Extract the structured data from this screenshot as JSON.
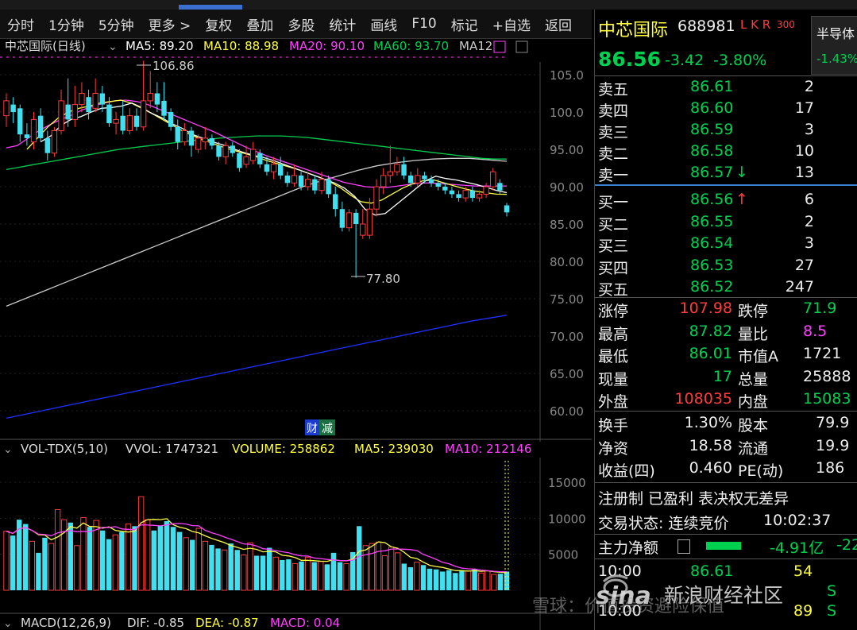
{
  "toolbar": {
    "items": [
      "分时",
      "1分钟",
      "5分钟",
      "更多 >",
      "复权",
      "叠加",
      "多股",
      "统计",
      "画线",
      "F10",
      "标记",
      "+自选",
      "返回"
    ]
  },
  "chart": {
    "main_title": "中芯国际(日线)",
    "ma5": "MA5: 89.20",
    "ma10": "MA10: 88.98",
    "ma20": "MA20: 90.10",
    "ma60": "MA60: 93.70",
    "ma120": "MA12",
    "high_label": "106.86",
    "low_label": "77.80",
    "event_badge_1": "财",
    "event_badge_2": "减",
    "price_ticks": [
      "105.0",
      "100.0",
      "95.00",
      "90.00",
      "85.00",
      "80.00",
      "75.00",
      "70.00",
      "65.00",
      "60.00"
    ],
    "vol_title": "VOL-TDX(5,10)",
    "vvol": "VVOL: 1747321",
    "volume": "VOLUME: 258862",
    "vol_ma5": "MA5: 239030",
    "vol_ma10": "MA10: 212146",
    "vol_ticks": [
      "15000",
      "10000",
      "5000"
    ],
    "macd_title": "MACD(12,26,9)",
    "dif": "DIF: -0.85",
    "dea": "DEA: -0.87",
    "macd": "MACD: 0.04",
    "colors": {
      "up": "#ff3c3c",
      "down": "#40e0f0",
      "ma5": "#ffffff",
      "ma10": "#ffff40",
      "ma20": "#ff40ff",
      "ma60": "#00d050",
      "ma120": "#cccccc",
      "ma250": "#2030ff"
    }
  },
  "chart_data": {
    "type": "candlestick",
    "ylim": [
      58,
      108
    ],
    "price_ticks": [
      105,
      100,
      95,
      90,
      85,
      80,
      75,
      70,
      65,
      60
    ],
    "candles": [
      [
        99.5,
        101.5,
        98.0,
        102.5,
        "up"
      ],
      [
        101.0,
        100.0,
        98.5,
        102.0,
        "down"
      ],
      [
        100.5,
        97.0,
        96.0,
        101.0,
        "down"
      ],
      [
        97.0,
        96.5,
        95.5,
        98.5,
        "down"
      ],
      [
        96.0,
        99.0,
        95.0,
        100.0,
        "up"
      ],
      [
        99.5,
        96.5,
        96.0,
        100.5,
        "down"
      ],
      [
        96.5,
        94.5,
        93.5,
        97.5,
        "down"
      ],
      [
        94.5,
        97.5,
        94.0,
        98.0,
        "up"
      ],
      [
        97.5,
        101.5,
        97.0,
        103.0,
        "up"
      ],
      [
        101.0,
        99.0,
        98.0,
        104.5,
        "down"
      ],
      [
        99.0,
        101.0,
        98.0,
        103.5,
        "up"
      ],
      [
        101.0,
        102.5,
        100.0,
        104.0,
        "up"
      ],
      [
        102.0,
        100.0,
        99.0,
        103.0,
        "down"
      ],
      [
        100.5,
        102.5,
        100.0,
        104.5,
        "up"
      ],
      [
        102.5,
        101.0,
        100.0,
        103.5,
        "down"
      ],
      [
        101.0,
        98.5,
        98.0,
        102.0,
        "down"
      ],
      [
        98.5,
        99.0,
        97.0,
        100.0,
        "up"
      ],
      [
        99.5,
        97.5,
        97.0,
        101.5,
        "down"
      ],
      [
        97.5,
        99.5,
        97.0,
        100.5,
        "up"
      ],
      [
        99.5,
        98.0,
        97.5,
        100.5,
        "down"
      ],
      [
        98.0,
        101.5,
        97.5,
        106.86,
        "up"
      ],
      [
        101.5,
        102.5,
        100.5,
        105.5,
        "up"
      ],
      [
        102.5,
        101.0,
        100.0,
        104.0,
        "down"
      ],
      [
        101.5,
        99.5,
        99.0,
        104.0,
        "down"
      ],
      [
        100.0,
        98.0,
        97.5,
        100.5,
        "down"
      ],
      [
        98.0,
        96.0,
        95.0,
        99.0,
        "down"
      ],
      [
        96.0,
        97.5,
        95.5,
        98.5,
        "up"
      ],
      [
        97.5,
        95.5,
        94.0,
        98.0,
        "down"
      ],
      [
        95.0,
        96.5,
        94.5,
        97.0,
        "up"
      ],
      [
        96.0,
        96.5,
        95.0,
        98.0,
        "up"
      ],
      [
        96.5,
        95.5,
        95.0,
        97.0,
        "down"
      ],
      [
        95.5,
        94.0,
        93.5,
        96.0,
        "down"
      ],
      [
        94.0,
        95.5,
        93.0,
        96.0,
        "up"
      ],
      [
        95.5,
        94.5,
        94.0,
        96.0,
        "down"
      ],
      [
        94.5,
        92.5,
        92.0,
        95.0,
        "down"
      ],
      [
        93.0,
        94.0,
        92.5,
        95.5,
        "up"
      ],
      [
        93.5,
        95.0,
        93.0,
        96.0,
        "up"
      ],
      [
        94.5,
        93.0,
        92.5,
        95.0,
        "down"
      ],
      [
        93.0,
        92.0,
        91.5,
        94.0,
        "down"
      ],
      [
        92.0,
        93.0,
        91.0,
        94.0,
        "up"
      ],
      [
        93.0,
        91.5,
        91.0,
        94.0,
        "down"
      ],
      [
        91.5,
        90.5,
        90.0,
        92.0,
        "down"
      ],
      [
        90.5,
        91.5,
        90.0,
        93.0,
        "up"
      ],
      [
        91.5,
        90.0,
        89.5,
        92.0,
        "down"
      ],
      [
        90.0,
        91.0,
        89.5,
        92.0,
        "up"
      ],
      [
        91.0,
        89.5,
        89.0,
        91.5,
        "down"
      ],
      [
        89.5,
        91.0,
        89.0,
        92.0,
        "up"
      ],
      [
        91.0,
        89.0,
        88.5,
        91.5,
        "down"
      ],
      [
        89.0,
        87.0,
        86.0,
        90.0,
        "down"
      ],
      [
        87.0,
        84.5,
        84.0,
        88.0,
        "down"
      ],
      [
        84.5,
        86.5,
        84.0,
        87.0,
        "up"
      ],
      [
        86.5,
        85.0,
        77.8,
        87.0,
        "down"
      ],
      [
        85.0,
        83.5,
        83.0,
        87.0,
        "up"
      ],
      [
        83.5,
        87.0,
        83.0,
        88.5,
        "up"
      ],
      [
        87.0,
        90.0,
        86.0,
        91.0,
        "up"
      ],
      [
        90.0,
        91.5,
        89.0,
        92.5,
        "up"
      ],
      [
        91.5,
        92.0,
        90.5,
        95.5,
        "up"
      ],
      [
        92.0,
        93.0,
        91.5,
        94.0,
        "up"
      ],
      [
        93.0,
        91.5,
        91.0,
        94.0,
        "down"
      ],
      [
        91.5,
        90.5,
        90.0,
        92.0,
        "down"
      ],
      [
        90.5,
        91.5,
        90.0,
        92.5,
        "up"
      ],
      [
        91.5,
        91.0,
        90.5,
        92.0,
        "down"
      ],
      [
        91.0,
        90.5,
        90.0,
        91.5,
        "down"
      ],
      [
        90.5,
        90.0,
        89.5,
        91.0,
        "down"
      ],
      [
        90.0,
        89.5,
        89.0,
        90.5,
        "down"
      ],
      [
        89.5,
        89.0,
        88.5,
        90.0,
        "down"
      ],
      [
        89.0,
        88.5,
        88.0,
        89.5,
        "down"
      ],
      [
        88.5,
        89.5,
        88.0,
        90.0,
        "up"
      ],
      [
        89.5,
        88.5,
        88.0,
        90.0,
        "down"
      ],
      [
        88.5,
        89.0,
        88.0,
        89.5,
        "up"
      ],
      [
        89.0,
        90.0,
        88.5,
        90.5,
        "up"
      ],
      [
        90.0,
        92.0,
        89.5,
        92.5,
        "up"
      ],
      [
        90.5,
        89.5,
        89.0,
        91.0,
        "down"
      ],
      [
        87.5,
        86.56,
        86.01,
        87.82,
        "down"
      ]
    ],
    "ma5": [
      96.0,
      96.8,
      98.2,
      99.0,
      99.4,
      100.0,
      100.5,
      100.6,
      100.8,
      101.2,
      100.6,
      99.8,
      99.2,
      98.4,
      97.8,
      97.0,
      96.5,
      96.0,
      95.6,
      95.1,
      94.6,
      94.2,
      93.9,
      93.5,
      93.0,
      92.5,
      92.0,
      91.5,
      91.0,
      90.5,
      89.8,
      88.7,
      87.0,
      86.2,
      86.4,
      87.5,
      88.6,
      89.7,
      90.8,
      91.4,
      91.1,
      90.9,
      90.6,
      90.3,
      89.9,
      89.5,
      89.2
    ],
    "ma10": [
      95.0,
      96.5,
      98.0,
      99.2,
      100.0,
      100.5,
      100.8,
      101.2,
      101.4,
      101.6,
      101.2,
      100.5,
      99.8,
      99.0,
      98.2,
      97.4,
      96.8,
      96.2,
      95.7,
      95.2,
      94.8,
      94.4,
      94.0,
      93.5,
      93.1,
      92.7,
      92.3,
      91.8,
      91.3,
      90.7,
      89.9,
      88.9,
      88.0,
      87.8,
      88.2,
      89.0,
      89.8,
      90.4,
      90.8,
      90.9,
      90.5,
      90.1,
      89.7,
      89.4,
      89.2,
      89.0,
      88.98
    ],
    "ma20": [
      95.2,
      95.5,
      96.5,
      97.5,
      98.3,
      99.0,
      99.6,
      100.3,
      100.8,
      101.2,
      101.5,
      101.6,
      101.4,
      101.0,
      100.4,
      99.8,
      99.2,
      98.6,
      98.0,
      97.4,
      96.7,
      96.0,
      95.3,
      94.7,
      94.1,
      93.6,
      93.1,
      92.6,
      92.1,
      91.6,
      91.1,
      90.6,
      90.3,
      90.0,
      89.9,
      89.9,
      90.1,
      90.3,
      90.5,
      90.5,
      90.4,
      90.3,
      90.2,
      90.1,
      90.1,
      90.1,
      90.1
    ],
    "ma60": [
      92.3,
      92.6,
      92.9,
      93.2,
      93.5,
      93.8,
      94.1,
      94.4,
      94.7,
      95.0,
      95.2,
      95.4,
      95.6,
      95.8,
      96.0,
      96.2,
      96.3,
      96.5,
      96.6,
      96.7,
      96.8,
      96.8,
      96.8,
      96.7,
      96.6,
      96.4,
      96.2,
      96.0,
      95.8,
      95.6,
      95.4,
      95.2,
      95.0,
      94.8,
      94.6,
      94.4,
      94.2,
      94.0,
      93.8,
      93.7,
      93.7
    ],
    "ma120": [
      74.0,
      75.0,
      76.0,
      77.0,
      78.0,
      79.0,
      80.0,
      81.0,
      82.0,
      83.0,
      84.0,
      85.0,
      86.0,
      87.0,
      88.0,
      89.0,
      90.0,
      90.8,
      91.5,
      92.2,
      92.8,
      93.2,
      93.5,
      93.7,
      93.8,
      93.8,
      93.6,
      93.4
    ],
    "ma250": [
      59.0,
      60.0,
      61.0,
      62.0,
      63.0,
      64.0,
      65.0,
      66.0,
      67.0,
      68.0,
      69.0,
      70.0,
      71.0,
      72.0,
      72.8
    ],
    "volume": [
      8200,
      7600,
      9800,
      9200,
      6800,
      5200,
      7300,
      6500,
      11200,
      9800,
      9400,
      6200,
      10100,
      8800,
      9700,
      8300,
      7100,
      7700,
      8100,
      9200,
      8900,
      13000,
      9800,
      8300,
      9000,
      9600,
      8800,
      8100,
      7300,
      7000,
      8600,
      6800,
      6300,
      5800,
      5600,
      6500,
      5600,
      4900,
      6600,
      4800,
      4800,
      5900,
      4600,
      4200,
      4300,
      3700,
      4000,
      4600,
      3900,
      4000,
      3600,
      5200,
      3900,
      3700,
      5300,
      8900,
      6200,
      6500,
      6700,
      4800,
      6000,
      5200,
      3700,
      3200,
      3900,
      3500,
      3000,
      2900,
      2600,
      2800,
      2400,
      2800,
      2700,
      2900,
      2400,
      2700,
      2200,
      2300,
      2600
    ]
  },
  "quote": {
    "name": "中芯国际",
    "code": "688981",
    "tags": "L K R",
    "tag300": "300",
    "price": "86.56",
    "change": "-3.42",
    "change_pct": "-3.80%",
    "sector_name": "半导体",
    "sector_pct": "-1.43%",
    "asks": [
      {
        "label": "卖五",
        "price": "86.61",
        "vol": "2"
      },
      {
        "label": "卖四",
        "price": "86.60",
        "vol": "17"
      },
      {
        "label": "卖三",
        "price": "86.59",
        "vol": "3"
      },
      {
        "label": "卖二",
        "price": "86.58",
        "vol": "10"
      },
      {
        "label": "卖一",
        "price": "86.57",
        "vol": "13",
        "arrow": "↓"
      }
    ],
    "bids": [
      {
        "label": "买一",
        "price": "86.56",
        "vol": "6",
        "arrow": "↑"
      },
      {
        "label": "买二",
        "price": "86.55",
        "vol": "2"
      },
      {
        "label": "买三",
        "price": "86.54",
        "vol": "3"
      },
      {
        "label": "买四",
        "price": "86.53",
        "vol": "27"
      },
      {
        "label": "买五",
        "price": "86.52",
        "vol": "247"
      }
    ],
    "stats": [
      {
        "l1": "涨停",
        "v1": "107.98",
        "c1": "red",
        "l2": "跌停",
        "v2": "71.9",
        "c2": "green"
      },
      {
        "l1": "最高",
        "v1": "87.82",
        "c1": "green",
        "l2": "量比",
        "v2": "8.5",
        "c2": "mag"
      },
      {
        "l1": "最低",
        "v1": "86.01",
        "c1": "green",
        "l2": "市值A",
        "v2": "1721",
        "c2": "white"
      },
      {
        "l1": "现量",
        "v1": "17",
        "c1": "green",
        "l2": "总量",
        "v2": "25888",
        "c2": "white"
      },
      {
        "l1": "外盘",
        "v1": "108035",
        "c1": "red",
        "l2": "内盘",
        "v2": "15083",
        "c2": "green"
      }
    ],
    "stats2": [
      {
        "l1": "换手",
        "v1": "1.30%",
        "l2": "股本",
        "v2": "79.9"
      },
      {
        "l1": "净资",
        "v1": "18.58",
        "l2": "流通",
        "v2": "19.9"
      },
      {
        "l1": "收益(四)",
        "v1": "0.460",
        "l2": "PE(动)",
        "v2": "186"
      }
    ],
    "reg_line": "注册制 已盈利 表决权无差异",
    "status_label": "交易状态: 连续竞价",
    "status_time": "10:02:37",
    "mainflow_label": "主力净额",
    "mainflow_value": "-4.91亿",
    "mainflow_extra": "-22",
    "ticks": [
      {
        "time": "10:00",
        "price": "86.61",
        "vol": "54",
        "bs": ""
      },
      {
        "time": "",
        "price": "",
        "vol": "",
        "bs": "S"
      },
      {
        "time": "10:00",
        "price": "",
        "vol": "89",
        "bs": "S"
      }
    ]
  },
  "watermark": {
    "brand": "sina",
    "text": "新浪财经社区",
    "text2": "雪球：价值投资避险保值"
  }
}
